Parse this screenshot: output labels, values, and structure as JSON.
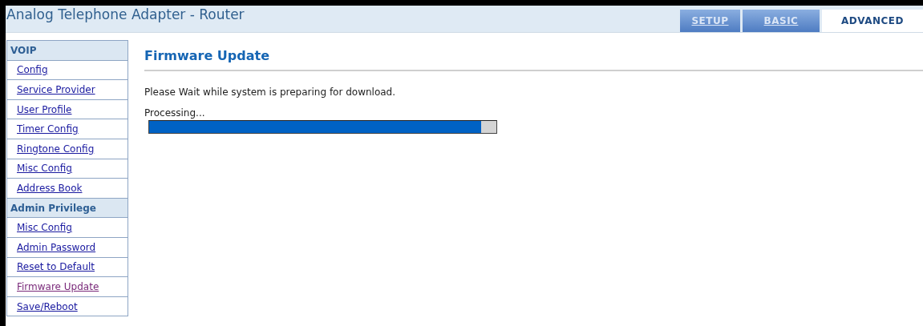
{
  "header": {
    "title": "Analog Telephone Adapter - Router"
  },
  "tabs": [
    {
      "label": "SETUP",
      "selected": false
    },
    {
      "label": "BASIC",
      "selected": false
    },
    {
      "label": "ADVANCED",
      "selected": true
    }
  ],
  "sidebar": {
    "items": [
      {
        "kind": "heading",
        "label": "VOIP"
      },
      {
        "kind": "link",
        "label": "Config",
        "selected": false
      },
      {
        "kind": "link",
        "label": "Service Provider",
        "selected": false
      },
      {
        "kind": "link",
        "label": "User Profile",
        "selected": false
      },
      {
        "kind": "link",
        "label": "Timer Config",
        "selected": false
      },
      {
        "kind": "link",
        "label": "Ringtone Config",
        "selected": false
      },
      {
        "kind": "link",
        "label": "Misc Config",
        "selected": false
      },
      {
        "kind": "link",
        "label": "Address Book",
        "selected": false
      },
      {
        "kind": "heading",
        "label": "Admin Privilege"
      },
      {
        "kind": "link",
        "label": "Misc Config",
        "selected": false
      },
      {
        "kind": "link",
        "label": "Admin Password",
        "selected": false
      },
      {
        "kind": "link",
        "label": "Reset to Default",
        "selected": false
      },
      {
        "kind": "link",
        "label": "Firmware Update",
        "selected": true
      },
      {
        "kind": "link",
        "label": "Save/Reboot",
        "selected": false
      }
    ]
  },
  "content": {
    "heading": "Firmware Update",
    "message": "Please Wait while system is preparing for download.",
    "progress": {
      "label": "Processing...",
      "level": 0.955
    }
  }
}
